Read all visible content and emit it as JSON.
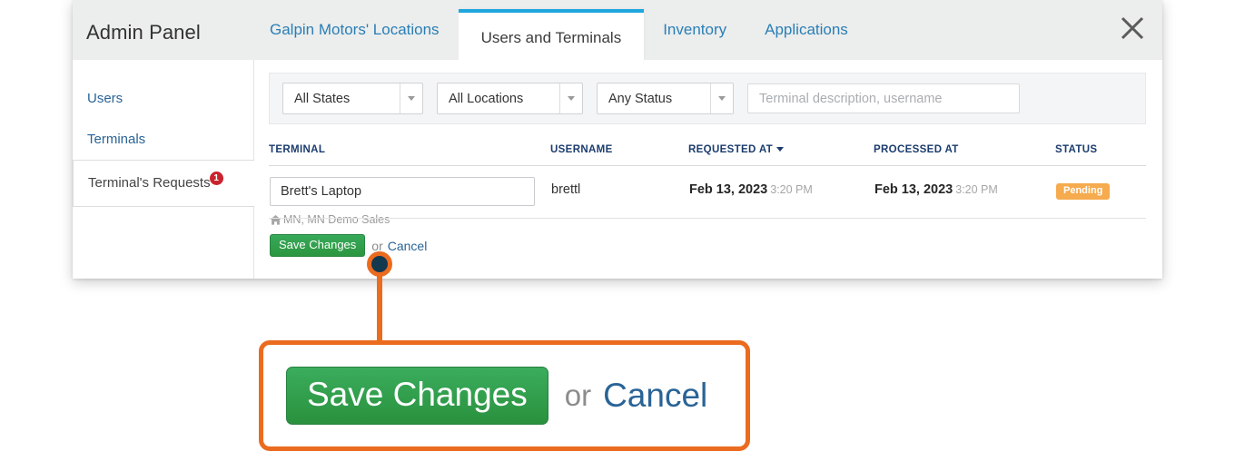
{
  "header": {
    "app_title": "Admin Panel",
    "tabs": [
      {
        "label": "Galpin Motors' Locations",
        "active": false
      },
      {
        "label": "Users and Terminals",
        "active": true
      },
      {
        "label": "Inventory",
        "active": false
      },
      {
        "label": "Applications",
        "active": false
      }
    ],
    "close_icon": "close-icon",
    "active_tab_accent": "#1fa7dd"
  },
  "sidebar": {
    "items": [
      {
        "label": "Users",
        "selected": false,
        "badge": ""
      },
      {
        "label": "Terminals",
        "selected": false,
        "badge": ""
      },
      {
        "label": "Terminal's Requests",
        "selected": true,
        "badge": "1"
      }
    ],
    "badge_color": "#c9232d"
  },
  "filters": {
    "state_select": {
      "value": "All States",
      "arrow_icon": "chevron-down-icon"
    },
    "location_select": {
      "value": "All Locations",
      "arrow_icon": "chevron-down-icon"
    },
    "status_select": {
      "value": "Any Status",
      "arrow_icon": "chevron-down-icon"
    },
    "search": {
      "value": "",
      "placeholder": "Terminal description, username"
    }
  },
  "table": {
    "columns": [
      {
        "label": "TERMINAL",
        "sorted": false
      },
      {
        "label": "USERNAME",
        "sorted": false
      },
      {
        "label": "REQUESTED AT",
        "sorted": true
      },
      {
        "label": "PROCESSED AT",
        "sorted": false
      },
      {
        "label": "STATUS",
        "sorted": false
      }
    ],
    "rows": [
      {
        "terminal_value": "Brett's Laptop",
        "location_icon": "home-icon",
        "location_text": "MN, MN Demo Sales",
        "save_label": "Save Changes",
        "or_label": "or",
        "cancel_label": "Cancel",
        "username": "brettl",
        "requested_date": "Feb 13, 2023",
        "requested_time": "3:20 PM",
        "processed_date": "Feb 13, 2023",
        "processed_time": "3:20 PM",
        "status": "Pending",
        "status_color": "#f5ab4e"
      }
    ]
  },
  "callout": {
    "accent_color": "#eb6b1f",
    "dot_color": "#13394f",
    "save_label": "Save Changes",
    "or_label": "or",
    "cancel_label": "Cancel"
  }
}
